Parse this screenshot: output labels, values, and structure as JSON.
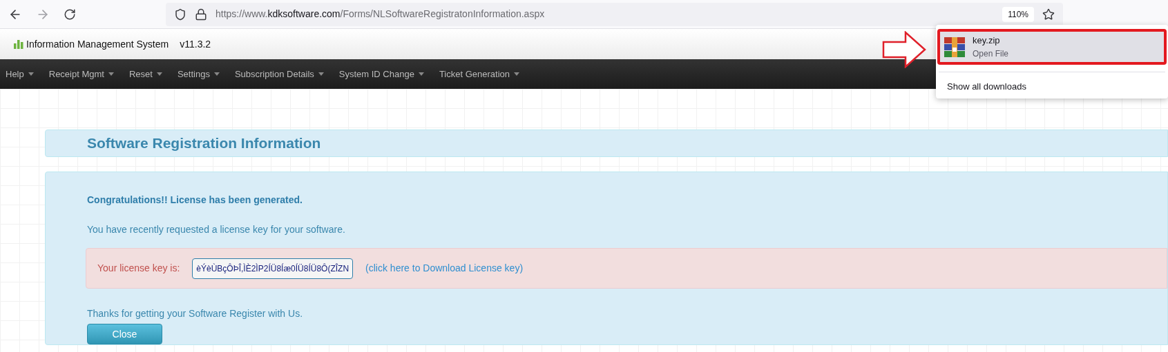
{
  "browser": {
    "url": {
      "prefix": "https://www.",
      "domain": "kdksoftware.com",
      "path": "/Forms/NLSoftwareRegistratonInformation.aspx"
    },
    "zoom": "110%"
  },
  "header": {
    "title": "Information Management System",
    "version": "v11.3.2"
  },
  "menu": [
    {
      "label": "Help"
    },
    {
      "label": "Receipt Mgmt"
    },
    {
      "label": "Reset"
    },
    {
      "label": "Settings"
    },
    {
      "label": "Subscription Details"
    },
    {
      "label": "System ID Change"
    },
    {
      "label": "Ticket Generation"
    }
  ],
  "downloads": {
    "items": [
      {
        "name": "key.zip",
        "action": "Open File"
      }
    ],
    "show_all": "Show all downloads"
  },
  "page": {
    "title": "Software Registration Information",
    "success": "Congratulations!! License has been generated.",
    "info": "You have recently requested a license key for your software.",
    "key_label": "Your license key is:",
    "key_value": "èÝèÙBçÔÞÎ,ÌÈ2ÌP2ÍÜ8Íæ0ÍÜ8ÍÜ8Ô(ZÎZN",
    "download_link": "(click here to Download License key)",
    "thanks": "Thanks for getting your Software Register with Us.",
    "close_button": "Close"
  }
}
